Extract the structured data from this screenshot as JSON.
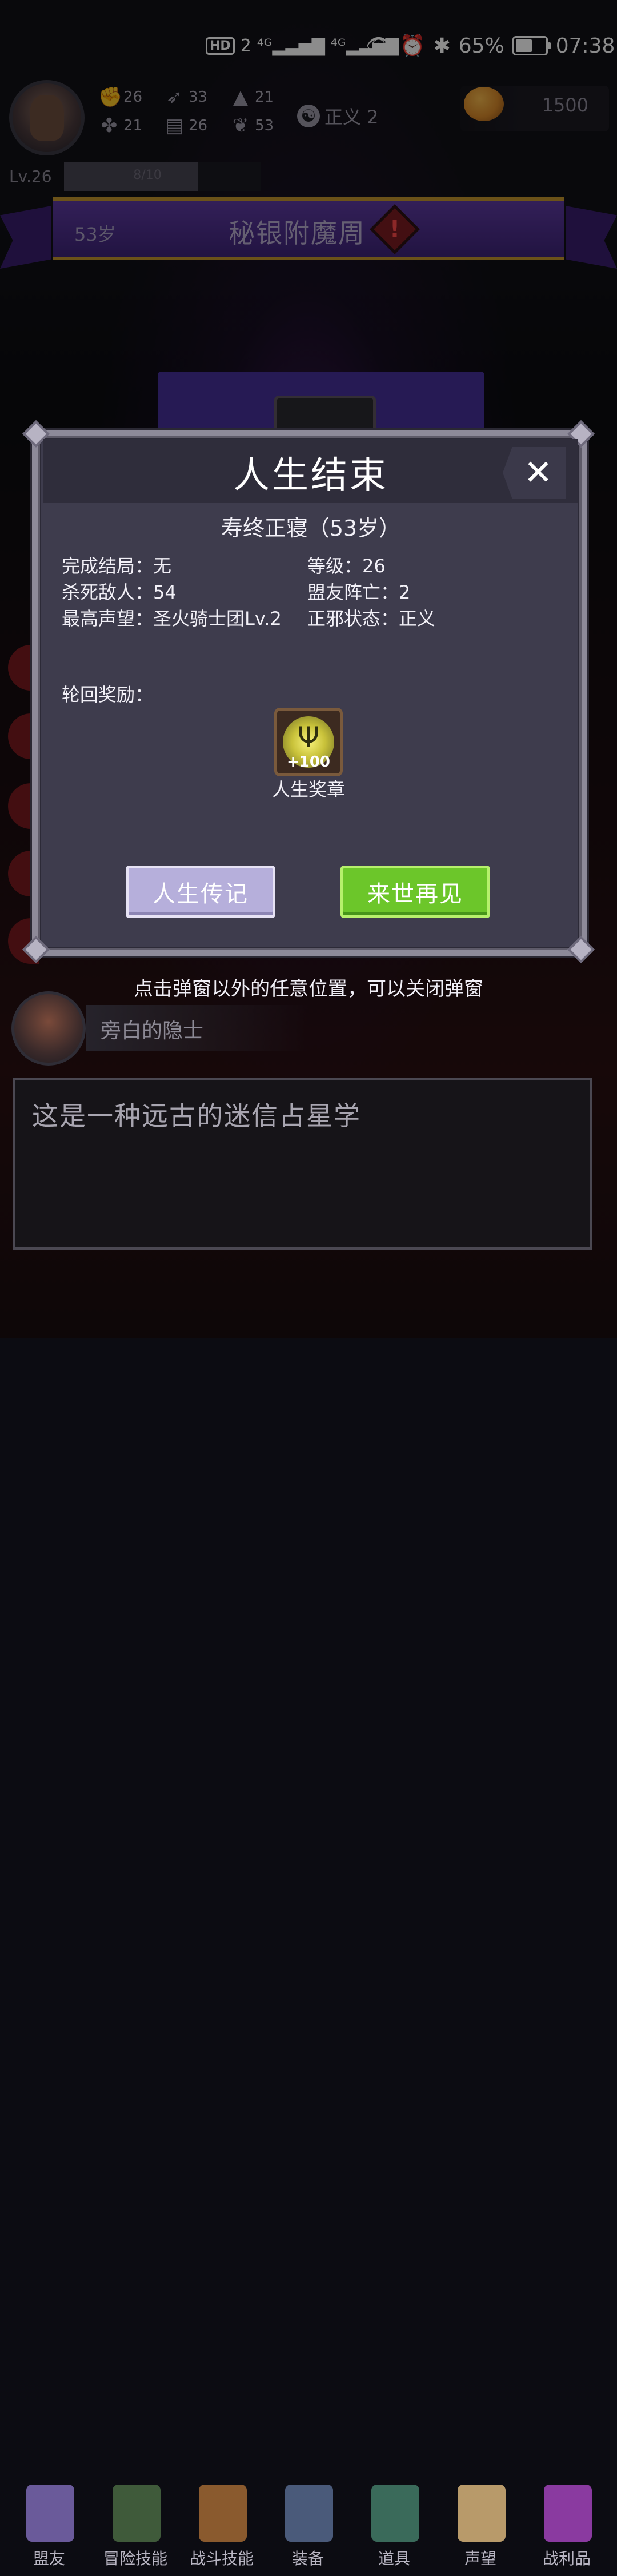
{
  "status_bar": {
    "network": "HD 2 4G 4G",
    "battery_percent": "65%",
    "battery_level": 0.65,
    "time": "07:38"
  },
  "hud": {
    "stats": [
      {
        "icon": "fist-icon",
        "value": "26"
      },
      {
        "icon": "clover-icon",
        "value": "21"
      },
      {
        "icon": "feather-icon",
        "value": "33"
      },
      {
        "icon": "book-icon",
        "value": "26"
      },
      {
        "icon": "wizard-hat-icon",
        "value": "21"
      },
      {
        "icon": "lotus-icon",
        "value": "53"
      }
    ],
    "alignment": "正义 2",
    "gold": "1500",
    "level": "Lv.26",
    "xp_text": "8/10",
    "xp_progress": 0.8
  },
  "banner": {
    "age": "53岁",
    "title": "秘银附魔周"
  },
  "modal": {
    "title": "人生结束",
    "subtitle": "寿终正寝（53岁）",
    "stats_left": [
      "完成结局：无",
      "杀死敌人：54",
      "最高声望：圣火骑士团Lv.2"
    ],
    "stats_right": [
      "等级：26",
      "盟友阵亡：2",
      "正邪状态：正义"
    ],
    "rewards_label": "轮回奖励：",
    "reward": {
      "count": "+100",
      "name": "人生奖章"
    },
    "btn_biography": "人生传记",
    "btn_next_life": "来世再见"
  },
  "hint": "点击弹窗以外的任意位置，可以关闭弹窗",
  "npc": {
    "name": "旁白的隐士"
  },
  "dialog": {
    "text": "这是一种远古的迷信占星学"
  },
  "nav": [
    {
      "label": "盟友",
      "color": "#6a5a9a"
    },
    {
      "label": "冒险技能",
      "color": "#3f5a3a"
    },
    {
      "label": "战斗技能",
      "color": "#8a5a2e"
    },
    {
      "label": "装备",
      "color": "#4a5a7a"
    },
    {
      "label": "道具",
      "color": "#3a6a5a"
    },
    {
      "label": "声望",
      "color": "#b89a6a"
    },
    {
      "label": "战利品",
      "color": "#8a3aa0"
    }
  ]
}
